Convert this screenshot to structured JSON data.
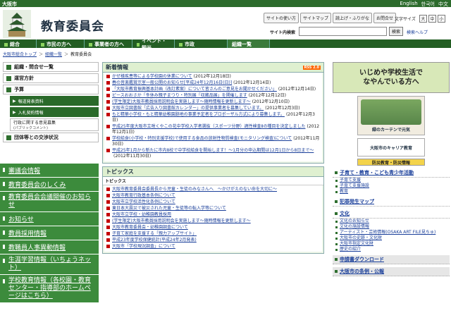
{
  "topbar": {
    "city": "大阪市",
    "langs": [
      "English",
      "한국어",
      "中文"
    ]
  },
  "header": {
    "title": "教育委員会",
    "util_buttons": [
      "サイトの使い方",
      "サイトマップ",
      "読上げ・ふりがな",
      "お問合せ"
    ],
    "font_size_label": "文字サイズ",
    "font_sizes": [
      "大",
      "中",
      "小"
    ],
    "search_label": "サイト内検索",
    "search_button": "検索",
    "search_help": "検索ヘルプ"
  },
  "gnav": [
    "総合",
    "市民の方へ",
    "事業者の方へ",
    "イベント・観光",
    "市政",
    "組織一覧"
  ],
  "breadcrumb": [
    "大阪市総合トップ",
    "組織一覧",
    "教育委員会"
  ],
  "left": {
    "items": [
      "組織・問合せ一覧",
      "運営方針",
      "予算"
    ],
    "sub": [
      "報道発表資料",
      "入札契約情報"
    ],
    "sub2": {
      "label": "行政に関する意見募集",
      "note": "(パブリックコメント)"
    },
    "item4": "団体等との交渉状況",
    "links": [
      "審議会情報",
      "教育委員会のしくみ",
      "教育委員会会議開催のお知らせ",
      "お知らせ",
      "教員採用情報",
      "教職員人事異動情報",
      "生涯学習情報（いちょうネット）",
      "学校教育情報（各校園・教育センター・指導部のホームページはこちら）"
    ]
  },
  "news": {
    "title": "新着情報",
    "rss": "RSS 2.0",
    "items": [
      {
        "t": "かぜ様疾患等による学校園の休業について",
        "d": "(2012年12月18日)"
      },
      {
        "t": "春の音楽鑑賞示室一般公開のお知らせ[平成24年12月16日(日)]",
        "d": "(2012年12月14日)"
      },
      {
        "t": "「大阪市教育振興基本計画（改訂素案）について皆さんのご意見をお聞かせください」",
        "d": "(2012年12月14日)"
      },
      {
        "t": "ピースおおさか「冬休み親子まつり・特別展「収蔵品展」を開催します",
        "d": "(2012年12月12日)"
      },
      {
        "t": "(学生限定)大阪市教員採用説明会を実施します～随時情報を更新します～",
        "d": "(2012年12月10日)"
      },
      {
        "t": "大阪市立図書館「広告入り図書館カレンダー」の提供事業者を募集しています。",
        "d": "(2012年12月3日)"
      },
      {
        "t": "もと精華小学校・もと精華幼稚園跡地の事業予定者をプロポーザル方式により募集します。",
        "d": "(2012年12月3日)"
      },
      {
        "t": "平成25年度大阪市立咲くやこの花中学校入学者選抜（スポーツ分野）適性検査Ⅱの種目を決定しました",
        "d": "(2012年12月1日)"
      },
      {
        "t": "学校給食(小学校・特別支援学校)で使用する食品の放射性物質検査(モニタリング検査)について",
        "d": "(2012年11月30日)"
      },
      {
        "t": "平成25年1月から新たに市内8校で中学校給食を開始します！～1月分の申込期間は12月1日から8日まで～",
        "d": "(2012年11月30日)"
      }
    ]
  },
  "topics": {
    "title": "トピックス",
    "sub": "トピックス",
    "items": [
      "大阪市教育委員会委員長から児童・生徒のみなさんへ　～かけがえのない命を大切に～",
      "大阪市教育行政基本条例について",
      "大阪市立学校活性化条例について",
      "東日本大震災で被災された児童・生徒等の転入学等について",
      "大阪市立学校・幼稚園教員採用",
      "(学生限定)大阪市教員採用説明会を実施します～随時情報を更新します～",
      "大阪市教育委員会・幼稚園調査について",
      "子育て家庭を支援する「親力アップサイト」",
      "平成23年度学校保健統計(平成24年2月発表)",
      "大阪市「学校現況調査」について"
    ]
  },
  "right": {
    "ijime": [
      "いじめや学校生活で",
      "なやんでいる方へ"
    ],
    "kids": "緑のカーテンで元気",
    "career": "大阪市のキャリア教育",
    "bosai": "防災教育・防災情報",
    "sec1": {
      "title": "子育て・教育・こども青少年活動",
      "items": [
        "子育て支援",
        "子育て支援施設",
        "教育"
      ]
    },
    "sec2": {
      "title": "犯罪発生マップ"
    },
    "sec3": {
      "title": "文化",
      "items": [
        "文化のお知らせ",
        "文化の施設情報",
        "アーティスト・芸術情報(OSAKA ART FILE見ちゅ)",
        "大阪市の史跡・文化財",
        "大阪市指定文化財",
        "歴史の紹介"
      ]
    },
    "sec4": {
      "title": "申請書ダウンロード"
    },
    "sec5": {
      "title": "大阪市の条例・公報"
    }
  }
}
